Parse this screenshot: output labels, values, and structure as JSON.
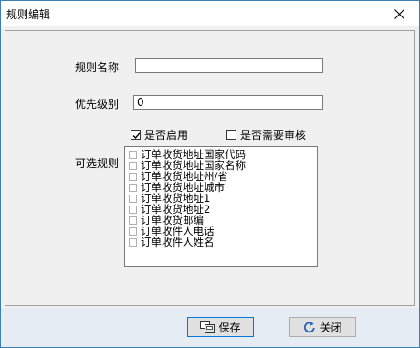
{
  "window": {
    "title": "规则编辑"
  },
  "form": {
    "rule_name_label": "规则名称",
    "rule_name_value": "",
    "priority_label": "优先级别",
    "priority_value": "0",
    "enabled_label": "是否启用",
    "enabled_checked": true,
    "need_review_label": "是否需要审核",
    "need_review_checked": false,
    "optional_rules_label": "可选规则",
    "optional_rules": [
      "订单收货地址国家代码",
      "订单收货地址国家名称",
      "订单收货地址州/省",
      "订单收货地址城市",
      "订单收货地址1",
      "订单收货地址2",
      "订单收货邮编",
      "订单收件人电话",
      "订单收件人姓名"
    ]
  },
  "buttons": {
    "save": "保存",
    "close": "关闭"
  },
  "icons": {
    "close": "close-icon",
    "save": "save-icon",
    "exit": "refresh-icon",
    "check": "check-icon"
  }
}
